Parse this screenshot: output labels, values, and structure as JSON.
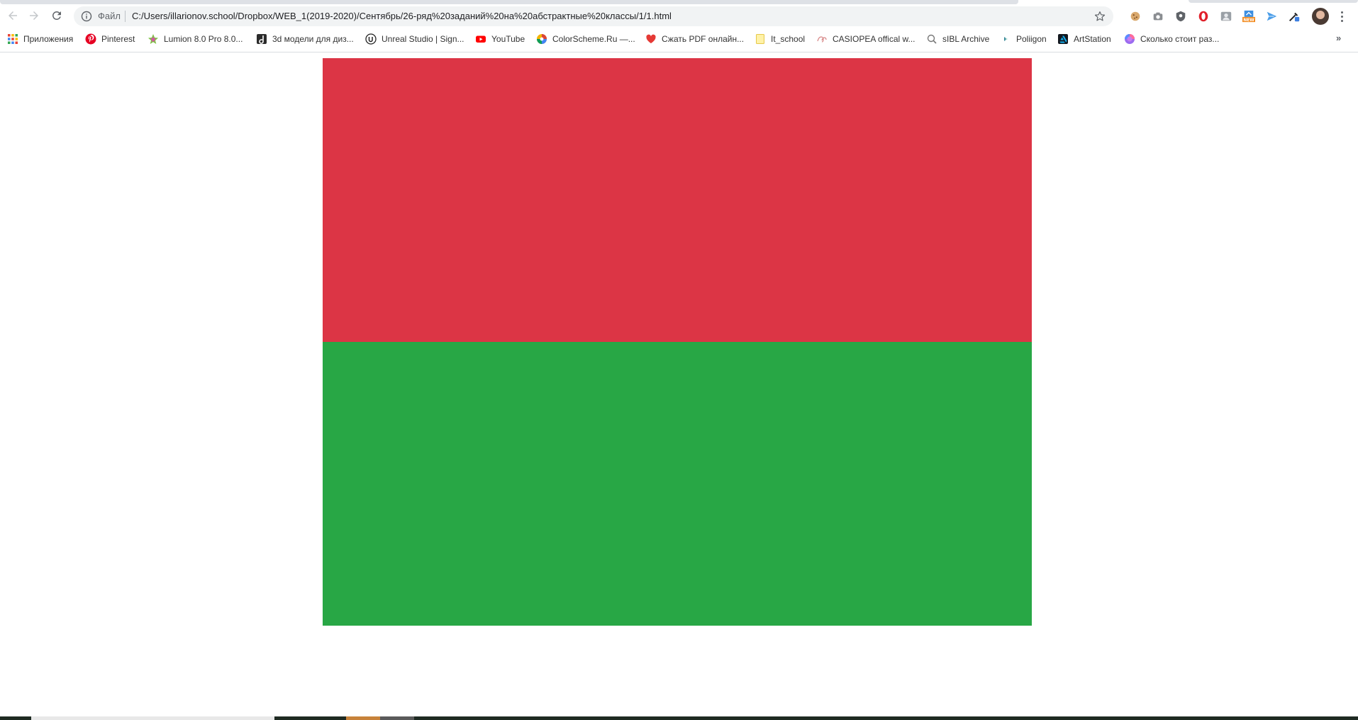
{
  "toolbar": {
    "scheme_label": "Файл",
    "url": "C:/Users/illarionov.school/Dropbox/WEB_1(2019-2020)/Сентябрь/26-ряд%20заданий%20на%20абстрактные%20классы/1/1.html"
  },
  "extensions": [
    {
      "icon": "extension-cookie-icon"
    },
    {
      "icon": "extension-camera-icon"
    },
    {
      "icon": "extension-shield-icon"
    },
    {
      "icon": "extension-opera-icon"
    },
    {
      "icon": "extension-person-icon"
    },
    {
      "icon": "extension-new-badge-icon",
      "badge": "NEW"
    },
    {
      "icon": "extension-send-icon"
    },
    {
      "icon": "extension-picker-icon"
    }
  ],
  "bookmarks": {
    "items": [
      {
        "label": "Приложения",
        "icon": "apps-grid-icon"
      },
      {
        "label": "Pinterest",
        "icon": "pinterest-icon"
      },
      {
        "label": "Lumion 8.0 Pro 8.0...",
        "icon": "lumion-icon"
      },
      {
        "label": "3d модели для диз...",
        "icon": "3d-models-icon"
      },
      {
        "label": "Unreal Studio | Sign...",
        "icon": "unreal-icon"
      },
      {
        "label": "YouTube",
        "icon": "youtube-icon"
      },
      {
        "label": "ColorScheme.Ru —...",
        "icon": "colorscheme-icon"
      },
      {
        "label": "Сжать PDF онлайн...",
        "icon": "pdf-heart-icon"
      },
      {
        "label": "It_school",
        "icon": "folder-icon"
      },
      {
        "label": "CASIOPEA offical w...",
        "icon": "casiopea-icon"
      },
      {
        "label": "sIBL Archive",
        "icon": "sibl-icon"
      },
      {
        "label": "Poliigon",
        "icon": "poliigon-icon"
      },
      {
        "label": "ArtStation",
        "icon": "artstation-icon"
      },
      {
        "label": "Сколько стоит раз...",
        "icon": "globe-gradient-icon"
      }
    ],
    "more": "»"
  },
  "content": {
    "red_block_color": "#dc3545",
    "green_block_color": "#28a745"
  }
}
